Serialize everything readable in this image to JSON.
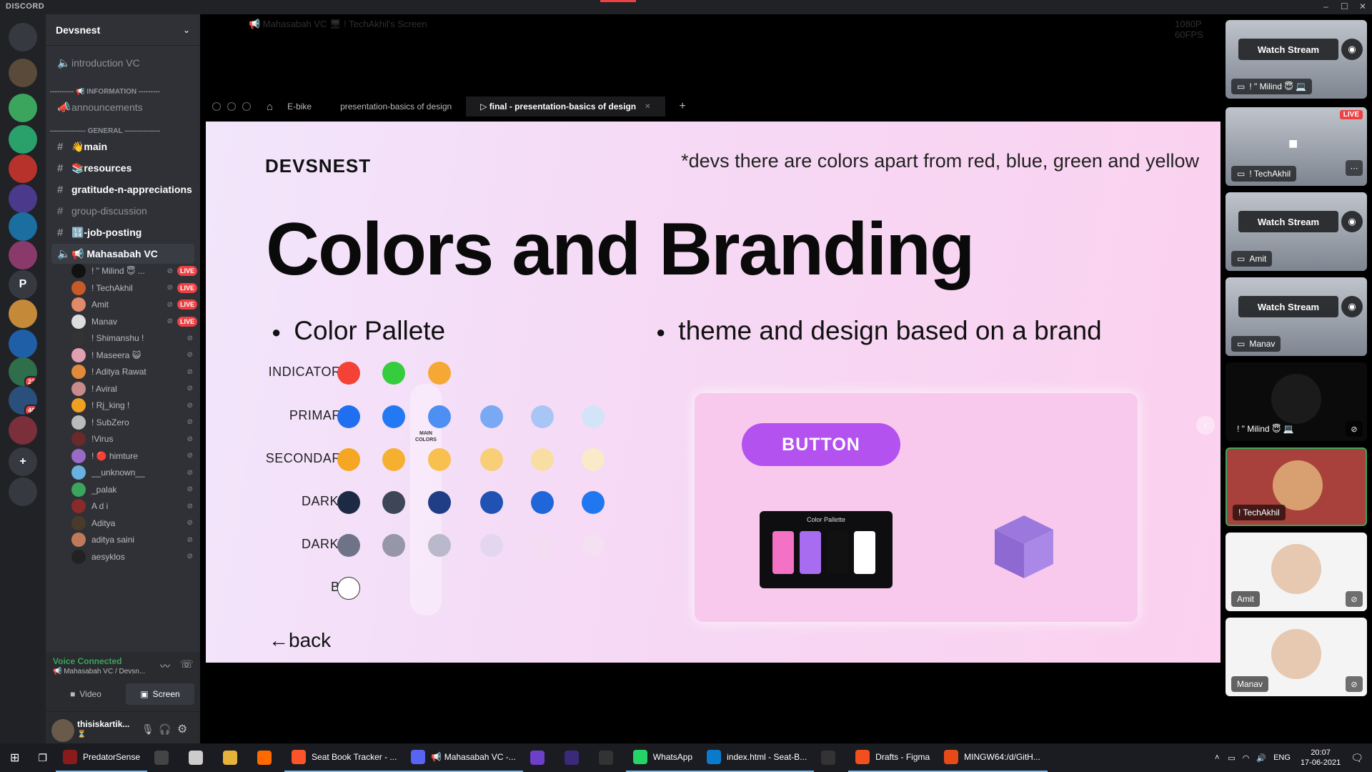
{
  "window": {
    "brand": "DISCORD",
    "minimize": "–",
    "maximize": "☐",
    "close": "✕"
  },
  "servers": [
    {
      "label": "",
      "color": "#36393f",
      "icon": "discord-home-icon"
    },
    {
      "label": "",
      "color": "#5a4a3a"
    },
    {
      "label": "",
      "color": "#3ba55d"
    },
    {
      "label": "",
      "color": "#2aa06a"
    },
    {
      "label": "",
      "color": "#b8322c"
    },
    {
      "label": "",
      "color": "#4b3a8c"
    },
    {
      "label": "",
      "color": "#1a6ea0"
    },
    {
      "label": "",
      "color": "#8a3a6a"
    },
    {
      "label": "P",
      "color": "#36393f"
    },
    {
      "label": "",
      "color": "#c48a3a"
    },
    {
      "label": "",
      "color": "#1f5fa8"
    },
    {
      "label": "",
      "color": "#2f6e4a",
      "badge": "22"
    },
    {
      "label": "",
      "color": "#2a4f7a",
      "badge": "40"
    },
    {
      "label": "",
      "color": "#7a2f3a"
    },
    {
      "label": "+",
      "color": "#36393f"
    },
    {
      "label": "",
      "color": "#36393f"
    }
  ],
  "guild": {
    "name": "Devsnest"
  },
  "channels": {
    "introduction_vc": "introduction VC",
    "cat_information": "---------- 📢 INFORMATION ---------",
    "announcements": "announcements",
    "cat_general": "--------------- GENERAL ---------------",
    "main": "👋main",
    "resources": "📚resources",
    "gratitude": "gratitude-n-appreciations",
    "group_discussion": "group-discussion",
    "job_posting": "🔢-job-posting",
    "mahasabah_vc": "📢 Mahasabah VC"
  },
  "voice_users": [
    {
      "name": "! \" Milind 😇 ...",
      "live": "LIVE",
      "color": "#111"
    },
    {
      "name": "! TechAkhil",
      "live": "LIVE",
      "color": "#c85a2a"
    },
    {
      "name": "Amit",
      "live": "LIVE",
      "color": "#e08a6a"
    },
    {
      "name": "Manav",
      "live": "LIVE",
      "color": "#ddd"
    },
    {
      "name": "! Shimanshu !",
      "live": "",
      "color": "#333"
    },
    {
      "name": "! Maseera 😺",
      "live": "",
      "color": "#e0a0b0"
    },
    {
      "name": "! Aditya Rawat",
      "live": "",
      "color": "#e08a3a"
    },
    {
      "name": "! Aviral",
      "live": "",
      "color": "#c88a8a"
    },
    {
      "name": "! Rj_king !",
      "live": "",
      "color": "#f0a020"
    },
    {
      "name": "! SubZero",
      "live": "",
      "color": "#bbb"
    },
    {
      "name": "!Virus",
      "live": "",
      "color": "#6a2a2a"
    },
    {
      "name": "! 🔴 himture",
      "live": "",
      "color": "#9a6ac8"
    },
    {
      "name": "__unknown__",
      "live": "",
      "color": "#6ab0e0"
    },
    {
      "name": "_palak",
      "live": "",
      "color": "#3ba55d"
    },
    {
      "name": "A d i",
      "live": "",
      "color": "#8a2a2a"
    },
    {
      "name": "Aditya",
      "live": "",
      "color": "#4a3a2a"
    },
    {
      "name": "aditya saini",
      "live": "",
      "color": "#c07a5a"
    },
    {
      "name": "aesyklos",
      "live": "",
      "color": "#222"
    }
  ],
  "voice_panel": {
    "status": "Voice Connected",
    "location": "📢 Mahasabah VC / Devsn...",
    "video": "Video",
    "screen": "Screen"
  },
  "user": {
    "name": "thisiskartik...",
    "sub": "⏳"
  },
  "stage": {
    "top_title": "📢 Mahasabah VC    🖥 ! TechAkhil's Screen",
    "quality": "1080P 60FPS"
  },
  "browser": {
    "tabs": [
      "E-bike",
      "presentation-basics of design",
      "▷  final - presentation-basics of design"
    ],
    "close": "✕",
    "new": "+"
  },
  "slide": {
    "brand": "DEVSNEST",
    "note": "*devs there are colors apart from red, blue, green and yellow",
    "title": "Colors and Branding",
    "bullet1": "Color Pallete",
    "bullet2": "theme and design based on a brand",
    "rows": [
      "INDICATORS",
      "PRIMARY",
      "SECONDARY",
      "DARK 1",
      "DARK 2",
      "BG"
    ],
    "main_colors": "MAIN COLORS",
    "swatches": {
      "indicators": [
        "#f44336",
        "#35cc3e",
        "#f5a833"
      ],
      "primary": [
        "#1f6ff0",
        "#2378f3",
        "#4d8ff2",
        "#7aa9f3",
        "#a8c6f5",
        "#d4e4f8"
      ],
      "secondary": [
        "#f5a623",
        "#f6b031",
        "#f7c04f",
        "#f8cf76",
        "#f9dea3",
        "#faeaca"
      ],
      "dark1": [
        "#1d2a44",
        "#3d4656",
        "#1f3e85",
        "#1f52b3",
        "#2066d8",
        "#2177ef"
      ],
      "dark2": [
        "#6e7388",
        "#9597a8",
        "#bab9cc",
        "#e3d6ee",
        "#f3ddf2",
        "#f5dff3"
      ],
      "bg": [
        "#ffffff"
      ]
    },
    "button": "BUTTON",
    "palette_title": "Color Pallette",
    "palette_colors": [
      "#f472c5",
      "#a86cf0",
      "#111111",
      "#ffffff"
    ],
    "back": "back"
  },
  "participants": [
    {
      "name": "! \" Milind 😇 💻",
      "watch": "Watch Stream",
      "type": "scr"
    },
    {
      "name": "! TechAkhil",
      "live": "LIVE",
      "type": "scr"
    },
    {
      "name": "Amit",
      "watch": "Watch Stream",
      "type": "scr"
    },
    {
      "name": "Manav",
      "watch": "Watch Stream",
      "type": "scr"
    },
    {
      "name": "! \" Milind 😇 💻",
      "type": "dark"
    },
    {
      "name": "! TechAkhil",
      "type": "hl"
    },
    {
      "name": "Amit",
      "type": "cam"
    },
    {
      "name": "Manav",
      "type": "cam"
    }
  ],
  "taskbar": {
    "items": [
      {
        "label": "PredatorSense",
        "color": "#8b1a1a"
      },
      {
        "label": "",
        "color": "#444"
      },
      {
        "label": "",
        "color": "#ccc"
      },
      {
        "label": "",
        "color": "#e6b33a"
      },
      {
        "label": "",
        "color": "#ff6a00"
      },
      {
        "label": "Seat Book Tracker - ...",
        "color": "#fb542b"
      },
      {
        "label": "📢 Mahasabah VC -...",
        "color": "#5865f2"
      },
      {
        "label": "",
        "color": "#6e40c9"
      },
      {
        "label": "",
        "color": "#3b2a7a"
      },
      {
        "label": "",
        "color": "#333"
      },
      {
        "label": "WhatsApp",
        "color": "#25d366"
      },
      {
        "label": "index.html - Seat-B...",
        "color": "#0a7acc"
      },
      {
        "label": "",
        "color": "#333"
      },
      {
        "label": "Drafts - Figma",
        "color": "#f24e1e"
      },
      {
        "label": "MINGW64:/d/GitH...",
        "color": "#e64a19"
      }
    ],
    "lang": "ENG",
    "time": "20:07",
    "date": "17-06-2021"
  }
}
